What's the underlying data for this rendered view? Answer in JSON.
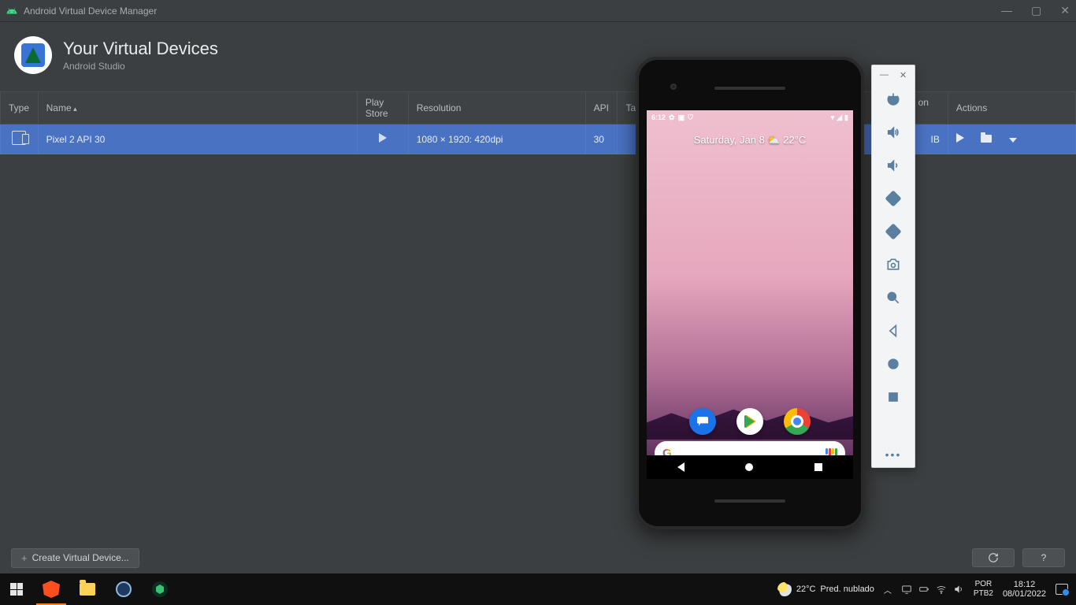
{
  "window": {
    "title": "Android Virtual Device Manager",
    "header_title": "Your Virtual Devices",
    "header_sub": "Android Studio"
  },
  "columns": {
    "type": "Type",
    "name": "Name",
    "play": "Play Store",
    "res": "Resolution",
    "api": "API",
    "target": "Target",
    "disk": "Size on Disk",
    "actions": "Actions"
  },
  "row": {
    "name": "Pixel 2 API 30",
    "res": "1080 × 1920: 420dpi",
    "api": "30",
    "target_hidden_suffix": "IB"
  },
  "footer": {
    "create": "Create Virtual Device...",
    "help": "?"
  },
  "emulator": {
    "status_time": "6:12",
    "home_text": "Saturday, Jan 8 ⛅ 22°C"
  },
  "taskbar": {
    "weather_temp": "22°C",
    "weather_desc": "Pred. nublado",
    "lang1": "POR",
    "lang2": "PTB2",
    "time": "18:12",
    "date": "08/01/2022"
  }
}
